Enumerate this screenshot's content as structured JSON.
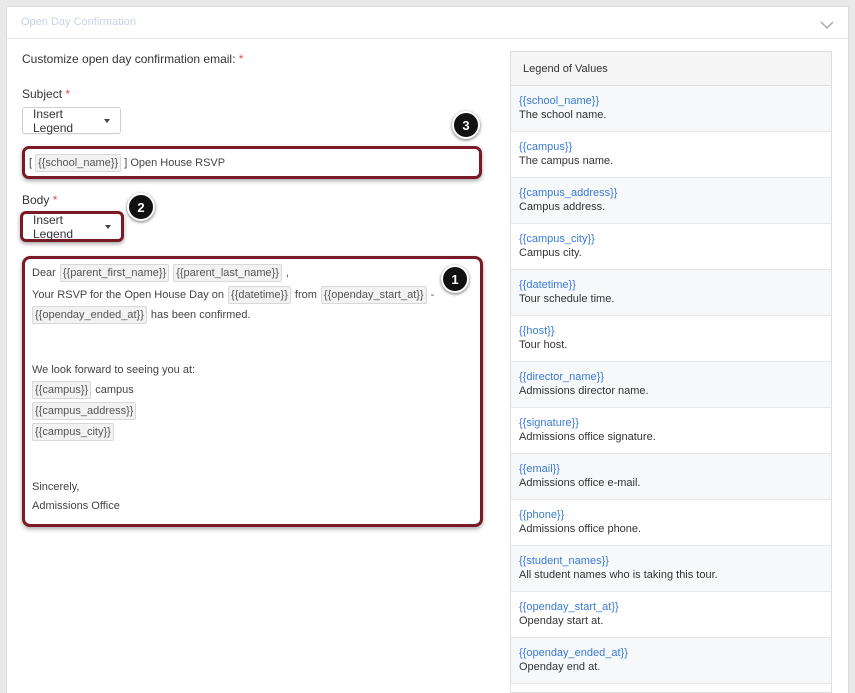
{
  "panel": {
    "title": "Open Day Confirmation"
  },
  "form": {
    "heading": "Customize open day confirmation email:",
    "required_mark": "*",
    "subject_label": "Subject",
    "body_label": "Body",
    "insert_legend_label": "Insert Legend",
    "subject": {
      "open_bracket": "[",
      "tag": "{{school_name}}",
      "rest": "] Open House RSVP"
    },
    "body": {
      "dear": "Dear",
      "parent_first": "{{parent_first_name}}",
      "parent_last": "{{parent_last_name}}",
      "comma": ",",
      "rsvp_text": "Your RSVP for the Open House Day on",
      "datetime": "{{datetime}}",
      "from": "from",
      "start": "{{openday_start_at}}",
      "dash": "-",
      "end": "{{openday_ended_at}}",
      "confirmed": "has been confirmed.",
      "look_forward": "We look forward to seeing you at:",
      "campus": "{{campus}}",
      "campus_word": "campus",
      "campus_address": "{{campus_address}}",
      "campus_city": "{{campus_city}}",
      "sincerely": "Sincerely,",
      "signoff": "Admissions Office"
    }
  },
  "callouts": {
    "one": "1",
    "two": "2",
    "three": "3"
  },
  "legend": {
    "title": "Legend of Values",
    "items": [
      {
        "key": "{{school_name}}",
        "desc": "The school name."
      },
      {
        "key": "{{campus}}",
        "desc": "The campus name."
      },
      {
        "key": "{{campus_address}}",
        "desc": "Campus address."
      },
      {
        "key": "{{campus_city}}",
        "desc": "Campus city."
      },
      {
        "key": "{{datetime}}",
        "desc": "Tour schedule time."
      },
      {
        "key": "{{host}}",
        "desc": "Tour host."
      },
      {
        "key": "{{director_name}}",
        "desc": "Admissions director name."
      },
      {
        "key": "{{signature}}",
        "desc": "Admissions office signature."
      },
      {
        "key": "{{email}}",
        "desc": "Admissions office e-mail."
      },
      {
        "key": "{{phone}}",
        "desc": "Admissions office phone."
      },
      {
        "key": "{{student_names}}",
        "desc": "All student names who is taking this tour."
      },
      {
        "key": "{{openday_start_at}}",
        "desc": "Openday start at."
      },
      {
        "key": "{{openday_ended_at}}",
        "desc": "Openday end at."
      }
    ]
  },
  "colors": {
    "accent_link": "#3a7bd5",
    "highlight_border": "#7a1a27",
    "required": "#d9534f"
  }
}
